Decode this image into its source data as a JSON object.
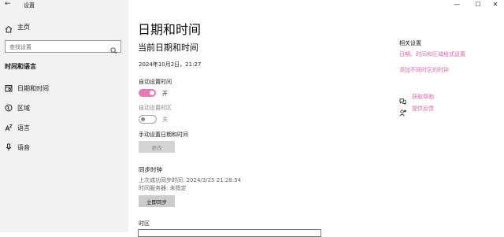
{
  "window": {
    "back_glyph": "←",
    "title": "设置",
    "controls": {
      "minimize": "—",
      "maximize": "☐",
      "close": "✕"
    }
  },
  "sidebar": {
    "home_label": "主页",
    "search": {
      "placeholder": "查找设置",
      "value": ""
    },
    "category": "时间和语言",
    "items": [
      {
        "label": "日期和时间",
        "icon": "calendar-icon",
        "glyph": "▤"
      },
      {
        "label": "区域",
        "icon": "globe-region-icon",
        "glyph": "◍"
      },
      {
        "label": "语言",
        "icon": "language-icon",
        "glyph": "Aᶻ"
      },
      {
        "label": "语音",
        "icon": "microphone-icon",
        "glyph": "🎤"
      }
    ]
  },
  "main": {
    "page_title": "日期和时间",
    "current_section_title": "当前日期和时间",
    "current_datetime": "2024年10月2日，21:27",
    "auto_time": {
      "label": "自动设置时间",
      "state_text": "开",
      "on": true
    },
    "auto_timezone": {
      "label": "自动设置时区",
      "state_text": "关",
      "on": false
    },
    "manual": {
      "label": "手动设置日期和时间",
      "button": "更改"
    },
    "sync": {
      "title": "同步时钟",
      "last_sync": "上次成功同步时间: 2024/3/25 21:28:54",
      "server": "时间服务器: 未指定",
      "button": "立即同步"
    },
    "timezone_label": "时区"
  },
  "related": {
    "title": "相关设置",
    "links": [
      "日期、时间和区域格式设置",
      "添加不同时区的时钟"
    ],
    "help": {
      "label": "获取帮助",
      "icon": "help-chat-icon"
    },
    "feedback": {
      "label": "提供反馈",
      "icon": "feedback-icon"
    }
  },
  "colors": {
    "accent": "#e879b6",
    "sidebar_bg": "#f2f2f2",
    "link": "#e06aa9"
  }
}
